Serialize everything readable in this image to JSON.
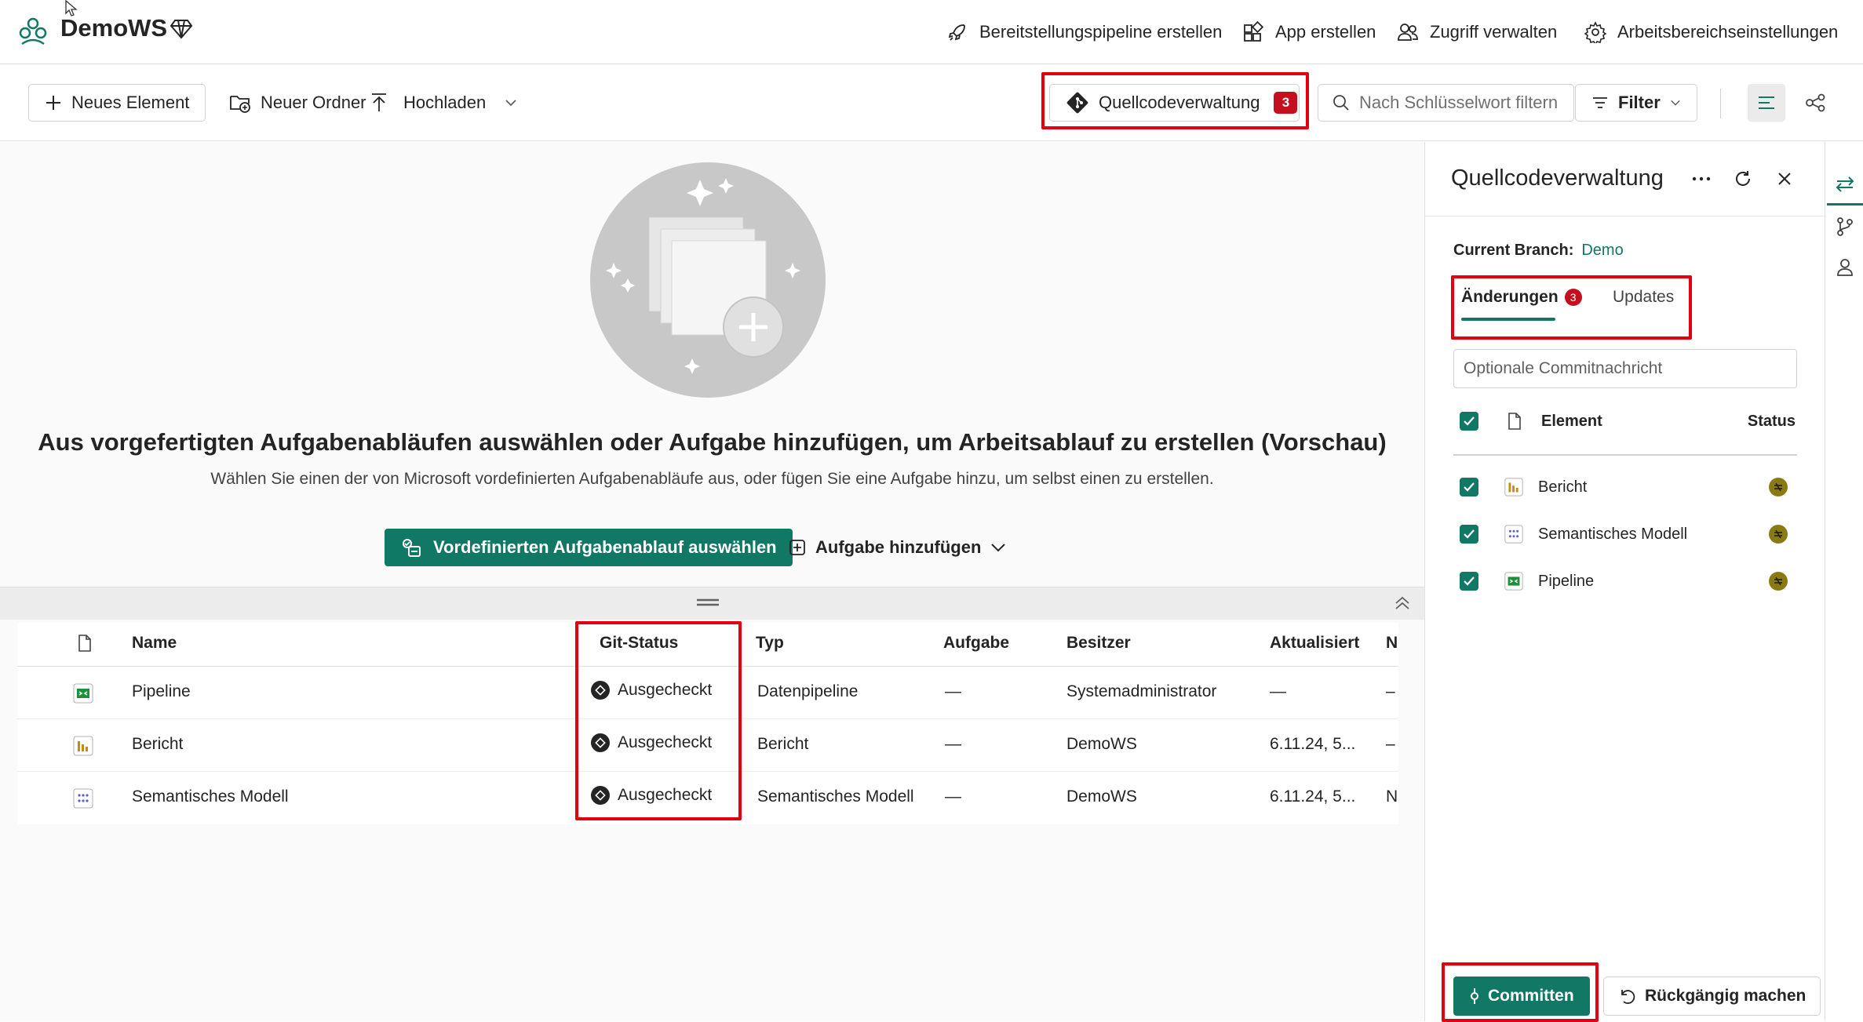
{
  "workspace": {
    "name": "DemoWS"
  },
  "top_actions": [
    {
      "label": "Bereitstellungspipeline erstellen",
      "icon": "rocket-icon"
    },
    {
      "label": "App erstellen",
      "icon": "app-icon"
    },
    {
      "label": "Zugriff verwalten",
      "icon": "people-icon"
    },
    {
      "label": "Arbeitsbereichseinstellungen",
      "icon": "gear-icon"
    }
  ],
  "toolbar": {
    "new_item": "Neues Element",
    "new_folder": "Neuer Ordner",
    "upload": "Hochladen",
    "source_control": "Quellcodeverwaltung",
    "source_control_count": "3",
    "filter_placeholder": "Nach Schlüsselwort filtern",
    "filter_button": "Filter"
  },
  "hero": {
    "title": "Aus vorgefertigten Aufgabenabläufen auswählen oder Aufgabe hinzufügen, um Arbeitsablauf zu erstellen (Vorschau)",
    "subtitle": "Wählen Sie einen der von Microsoft vordefinierten Aufgabenabläufe aus, oder fügen Sie eine Aufgabe hinzu, um selbst einen zu erstellen.",
    "primary_button": "Vordefinierten Aufgabenablauf auswählen",
    "secondary_button": "Aufgabe hinzufügen"
  },
  "table": {
    "columns": [
      "Name",
      "Git-Status",
      "Typ",
      "Aufgabe",
      "Besitzer",
      "Aktualisiert",
      "N"
    ],
    "rows": [
      {
        "name": "Pipeline",
        "icon": "pipeline-icon",
        "git_status": "Ausgecheckt",
        "type": "Datenpipeline",
        "task": "—",
        "owner": "Systemadministrator",
        "updated": "—",
        "extra": "–"
      },
      {
        "name": "Bericht",
        "icon": "report-icon",
        "git_status": "Ausgecheckt",
        "type": "Bericht",
        "task": "—",
        "owner": "DemoWS",
        "updated": "6.11.24, 5...",
        "extra": "–"
      },
      {
        "name": "Semantisches Modell",
        "icon": "semantic-model-icon",
        "git_status": "Ausgecheckt",
        "type": "Semantisches Modell",
        "task": "—",
        "owner": "DemoWS",
        "updated": "6.11.24, 5...",
        "extra": "N"
      }
    ]
  },
  "pane": {
    "title": "Quellcodeverwaltung",
    "branch_label": "Current Branch:",
    "branch_value": "Demo",
    "tab_changes": "Änderungen",
    "tab_changes_count": "3",
    "tab_updates": "Updates",
    "commit_placeholder": "Optionale Commitnachricht",
    "col_element": "Element",
    "col_status": "Status",
    "items": [
      {
        "name": "Bericht",
        "icon": "report-icon"
      },
      {
        "name": "Semantisches Modell",
        "icon": "semantic-model-icon"
      },
      {
        "name": "Pipeline",
        "icon": "pipeline-icon"
      }
    ],
    "commit_button": "Committen",
    "undo_button": "Rückgängig machen"
  },
  "colors": {
    "accent": "#117865",
    "highlight": "#e3000f",
    "badge": "#c50f1f",
    "status": "#8a7a14"
  }
}
